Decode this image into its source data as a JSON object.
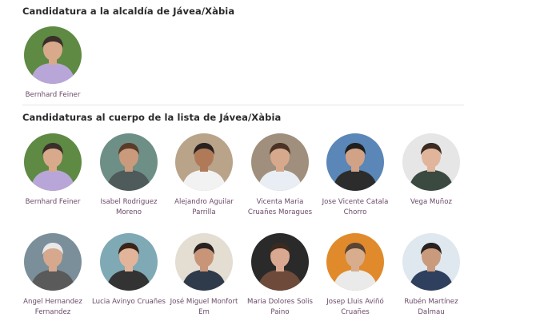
{
  "mayor_section": {
    "title": "Candidatura a la alcaldía de Jávea/Xàbia",
    "candidates": [
      {
        "name": "Bernhard Feiner",
        "bg": "#5e8a44",
        "skin": "#d9a98b",
        "shirt": "#b9a6d9",
        "hair": "#3a2f2a"
      }
    ]
  },
  "list_section": {
    "title": "Candidaturas al cuerpo de la lista de Jávea/Xàbia",
    "candidates": [
      {
        "name": "Bernhard Feiner",
        "bg": "#5e8a44",
        "skin": "#d9a98b",
        "shirt": "#b9a6d9",
        "hair": "#3a2f2a"
      },
      {
        "name": "Isabel Rodriguez Moreno",
        "bg": "#6e8f86",
        "skin": "#c99a7c",
        "shirt": "#4f5a5a",
        "hair": "#5a3b28"
      },
      {
        "name": "Alejandro Aguilar Parrilla",
        "bg": "#b9a48a",
        "skin": "#b07a58",
        "shirt": "#f2f2f2",
        "hair": "#2a2220"
      },
      {
        "name": "Vicenta Maria Cruañes Moragues",
        "bg": "#a08f7c",
        "skin": "#d6a98d",
        "shirt": "#e9eef4",
        "hair": "#4a3326"
      },
      {
        "name": "Jose Vicente Catala Chorro",
        "bg": "#5a86b8",
        "skin": "#d2a286",
        "shirt": "#2c2c2c",
        "hair": "#1f1f1f"
      },
      {
        "name": "Vega Muñoz",
        "bg": "#e6e6e6",
        "skin": "#e0b59b",
        "shirt": "#3a4a40",
        "hair": "#3b2b22"
      },
      {
        "name": "Angel Hernandez Fernandez",
        "bg": "#7a8f9a",
        "skin": "#d6a88e",
        "shirt": "#5a5a5a",
        "hair": "#e8e8e8"
      },
      {
        "name": "Lucia Avinyo Cruañes",
        "bg": "#7fa9b5",
        "skin": "#e2b49a",
        "shirt": "#333333",
        "hair": "#3a2418"
      },
      {
        "name": "José Miguel Monfort Em",
        "bg": "#e4ddd2",
        "skin": "#c89578",
        "shirt": "#2f3b4a",
        "hair": "#2a2220"
      },
      {
        "name": "Maria Dolores Solis Paino",
        "bg": "#2a2a2a",
        "skin": "#d9a890",
        "shirt": "#6d4a3a",
        "hair": "#3b2a20"
      },
      {
        "name": "Josep Lluis Aviñó Cruañes",
        "bg": "#e08a2c",
        "skin": "#d8ad8e",
        "shirt": "#eaeaea",
        "hair": "#5a4534"
      },
      {
        "name": "Rubén Martínez Dalmau",
        "bg": "#dfe8ee",
        "skin": "#c99a7c",
        "shirt": "#2f3f5e",
        "hair": "#2a2220"
      }
    ]
  }
}
